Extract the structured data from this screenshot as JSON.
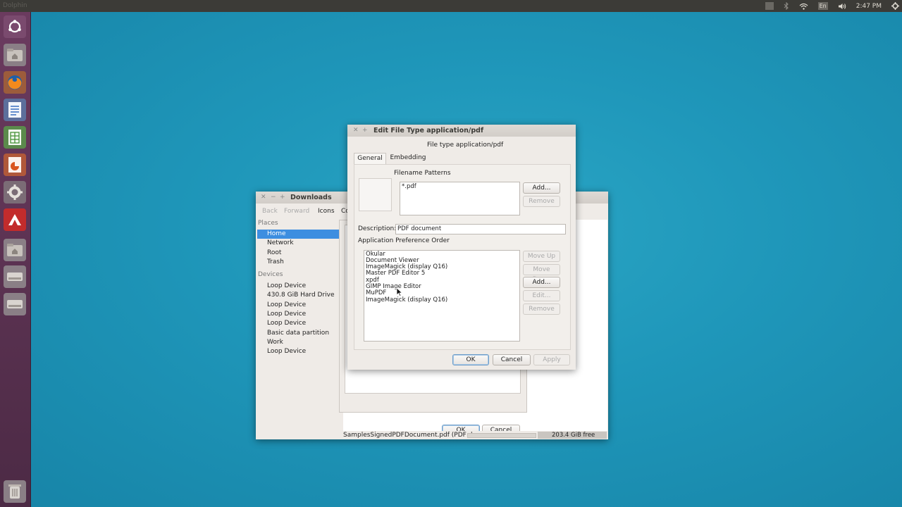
{
  "topbar": {
    "app_name": "Dolphin",
    "keyboard": "En",
    "time": "2:47 PM"
  },
  "launcher": {
    "items": [
      "ubuntu-dash-icon",
      "files-icon",
      "firefox-icon",
      "writer-icon",
      "calc-icon",
      "impress-icon",
      "system-settings-icon",
      "pdf-editor-icon",
      "files-icon",
      "disk-icon",
      "disk-icon",
      "trash-icon"
    ]
  },
  "downloads": {
    "title": "Downloads",
    "toolbar": {
      "back": "Back",
      "forward": "Forward",
      "icons": "Icons",
      "compact": "Co"
    },
    "places_heading": "Places",
    "places": [
      "Home",
      "Network",
      "Root",
      "Trash"
    ],
    "devices_heading": "Devices",
    "devices": [
      "Loop Device",
      "430.8 GiB Hard Drive",
      "Loop Device",
      "Loop Device",
      "Loop Device",
      "Basic data partition",
      "Work",
      "Loop Device"
    ],
    "status_file": "SamplesSignedPDFDocument.pdf (PDF d...",
    "status_free": "203.4 GiB free",
    "inner_ok": "OK",
    "inner_cancel": "Cancel"
  },
  "dialog": {
    "title": "Edit File Type application/pdf",
    "subtitle": "File type application/pdf",
    "tabs": [
      "General",
      "Embedding"
    ],
    "filename_patterns_label": "Filename Patterns",
    "patterns": [
      "*.pdf"
    ],
    "pattern_add": "Add...",
    "pattern_remove": "Remove",
    "description_label": "Description:",
    "description_value": "PDF document",
    "app_order_label": "Application Preference Order",
    "apps": [
      "Okular",
      "Document Viewer",
      "ImageMagick (display Q16)",
      "Master PDF Editor 5",
      "xpdf",
      "GIMP Image Editor",
      "MuPDF",
      "ImageMagick (display Q16)"
    ],
    "move_up": "Move Up",
    "move_down": "Move Down",
    "app_add": "Add...",
    "app_edit": "Edit...",
    "app_remove": "Remove",
    "ok": "OK",
    "cancel": "Cancel",
    "apply": "Apply"
  }
}
